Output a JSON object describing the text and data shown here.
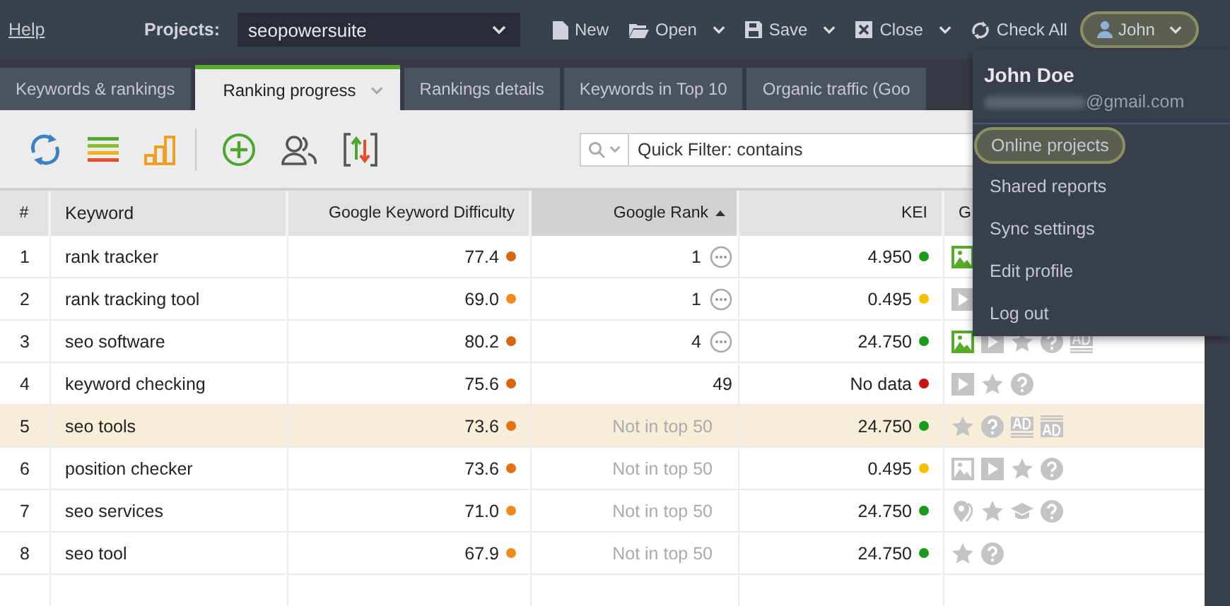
{
  "menu_bar": {
    "help": "Help",
    "projects_label": "Projects:",
    "project": "seopowersuite",
    "buttons": [
      {
        "kind": "new",
        "label": "New",
        "caret": false
      },
      {
        "kind": "open",
        "label": "Open",
        "caret": true
      },
      {
        "kind": "save",
        "label": "Save",
        "caret": true
      },
      {
        "kind": "close",
        "label": "Close",
        "caret": true
      },
      {
        "kind": "check",
        "label": "Check All",
        "caret": false
      }
    ],
    "user": {
      "label": "John",
      "selected": true
    }
  },
  "tabs": [
    {
      "label": "Keywords & rankings",
      "selected": false,
      "caret": false
    },
    {
      "label": "Ranking progress",
      "selected": true,
      "caret": true
    },
    {
      "label": "Rankings details",
      "selected": false,
      "caret": false
    },
    {
      "label": "Keywords in Top 10",
      "selected": false,
      "caret": false
    },
    {
      "label": "Organic traffic (Goo",
      "selected": false,
      "caret": false
    }
  ],
  "toolbar": {
    "search": {
      "placeholder": "Quick Filter: contains"
    }
  },
  "table": {
    "columns": [
      {
        "label": "#",
        "sorted": false
      },
      {
        "label": "Keyword",
        "sorted": false
      },
      {
        "label": "Google Keyword Difficulty",
        "sorted": false
      },
      {
        "label": "Google Rank",
        "sorted": true
      },
      {
        "label": "KEI",
        "sorted": false
      },
      {
        "label": "G",
        "sorted": false
      }
    ],
    "rows": [
      {
        "n": "1",
        "keyword": "rank tracker",
        "difficulty": {
          "value": "77.4",
          "color": "#d9640f"
        },
        "rank": "1",
        "in_top": true,
        "details": true,
        "kei": {
          "value": "4.950",
          "color": "#1a9a1a"
        },
        "selected": false,
        "features": [
          {
            "kind": "image",
            "active": true
          }
        ]
      },
      {
        "n": "2",
        "keyword": "rank tracking tool",
        "difficulty": {
          "value": "69.0",
          "color": "#f08a1c"
        },
        "rank": "1",
        "in_top": true,
        "details": true,
        "kei": {
          "value": "0.495",
          "color": "#f5c000"
        },
        "selected": false,
        "features": [
          {
            "kind": "video",
            "active": false
          }
        ]
      },
      {
        "n": "3",
        "keyword": "seo software",
        "difficulty": {
          "value": "80.2",
          "color": "#d9640f"
        },
        "rank": "4",
        "in_top": true,
        "details": true,
        "kei": {
          "value": "24.750",
          "color": "#1a9a1a"
        },
        "selected": false,
        "features": [
          {
            "kind": "image",
            "active": true
          },
          {
            "kind": "video",
            "active": false
          },
          {
            "kind": "star",
            "active": false
          },
          {
            "kind": "question",
            "active": false
          },
          {
            "kind": "ad",
            "active": false
          }
        ]
      },
      {
        "n": "4",
        "keyword": "keyword checking",
        "difficulty": {
          "value": "75.6",
          "color": "#d9640f"
        },
        "rank": "49",
        "in_top": true,
        "details": false,
        "kei": {
          "value": "No data",
          "color": "#cc1111"
        },
        "selected": false,
        "features": [
          {
            "kind": "video",
            "active": false
          },
          {
            "kind": "star",
            "active": false
          },
          {
            "kind": "question",
            "active": false
          }
        ]
      },
      {
        "n": "5",
        "keyword": "seo tools",
        "difficulty": {
          "value": "73.6",
          "color": "#e5720f"
        },
        "rank": "Not in top 50",
        "in_top": false,
        "details": false,
        "kei": {
          "value": "24.750",
          "color": "#1a9a1a"
        },
        "selected": true,
        "features": [
          {
            "kind": "star",
            "active": false
          },
          {
            "kind": "question",
            "active": false
          },
          {
            "kind": "ad",
            "active": false
          },
          {
            "kind": "ad_list",
            "active": false
          }
        ]
      },
      {
        "n": "6",
        "keyword": "position checker",
        "difficulty": {
          "value": "73.6",
          "color": "#e5720f"
        },
        "rank": "Not in top 50",
        "in_top": false,
        "details": false,
        "kei": {
          "value": "0.495",
          "color": "#f5c000"
        },
        "selected": false,
        "features": [
          {
            "kind": "image",
            "active": false
          },
          {
            "kind": "video",
            "active": false
          },
          {
            "kind": "star",
            "active": false
          },
          {
            "kind": "question",
            "active": false
          }
        ]
      },
      {
        "n": "7",
        "keyword": "seo services",
        "difficulty": {
          "value": "71.0",
          "color": "#f08a1c"
        },
        "rank": "Not in top 50",
        "in_top": false,
        "details": false,
        "kei": {
          "value": "24.750",
          "color": "#1a9a1a"
        },
        "selected": false,
        "features": [
          {
            "kind": "pin",
            "active": false
          },
          {
            "kind": "star",
            "active": false
          },
          {
            "kind": "cap",
            "active": false
          },
          {
            "kind": "question",
            "active": false
          }
        ]
      },
      {
        "n": "8",
        "keyword": "seo tool",
        "difficulty": {
          "value": "67.9",
          "color": "#f08a1c"
        },
        "rank": "Not in top 50",
        "in_top": false,
        "details": false,
        "kei": {
          "value": "24.750",
          "color": "#1a9a1a"
        },
        "selected": false,
        "features": [
          {
            "kind": "star",
            "active": false
          },
          {
            "kind": "question",
            "active": false
          }
        ]
      }
    ]
  },
  "user_menu": {
    "name": "John Doe",
    "email": "@gmail.com",
    "items": [
      {
        "label": "Online projects",
        "selected": true
      },
      {
        "label": "Shared reports",
        "selected": false
      },
      {
        "label": "Sync settings",
        "selected": false
      },
      {
        "label": "Edit profile",
        "selected": false
      },
      {
        "label": "Log out",
        "selected": false
      }
    ]
  }
}
